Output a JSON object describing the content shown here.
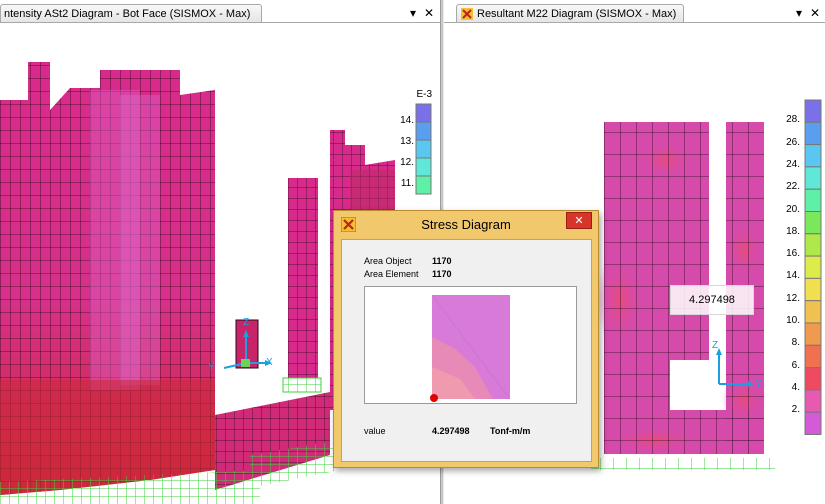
{
  "left_window": {
    "tab_title": "ntensity ASt2 Diagram - Bot Face  (SISMOX - Max)",
    "dropdown_glyph": "▾",
    "close_glyph": "✕",
    "legend": {
      "header": "E-3",
      "labels": [
        "14.",
        "13.",
        "12.",
        "11."
      ]
    },
    "axes": {
      "z": "Z",
      "x": "X",
      "y": "Y"
    }
  },
  "right_window": {
    "tab_title": "Resultant M22 Diagram  (SISMOX - Max)",
    "dropdown_glyph": "▾",
    "close_glyph": "✕",
    "tooltip_value": "4.297498",
    "legend": {
      "labels": [
        "28.",
        "26.",
        "24.",
        "22.",
        "20.",
        "18.",
        "16.",
        "14.",
        "12.",
        "10.",
        "8.",
        "6.",
        "4.",
        "2."
      ],
      "colors": [
        "#7a70e8",
        "#5a9ef0",
        "#5ac7f0",
        "#5fe8d8",
        "#5ff0a8",
        "#7ae85a",
        "#aee84a",
        "#dcec4a",
        "#f0e050",
        "#f0c050",
        "#f09a50",
        "#f07050",
        "#f04a60",
        "#e85ab0",
        "#d55ad8"
      ]
    },
    "axes": {
      "z": "Z",
      "y": "Y"
    }
  },
  "dialog": {
    "title": "Stress Diagram",
    "close_glyph": "✕",
    "area_object_label": "Area Object",
    "area_object_value": "1170",
    "area_element_label": "Area Element",
    "area_element_value": "1170",
    "value_label": "value",
    "value": "4.297498",
    "units": "Tonf-m/m"
  }
}
